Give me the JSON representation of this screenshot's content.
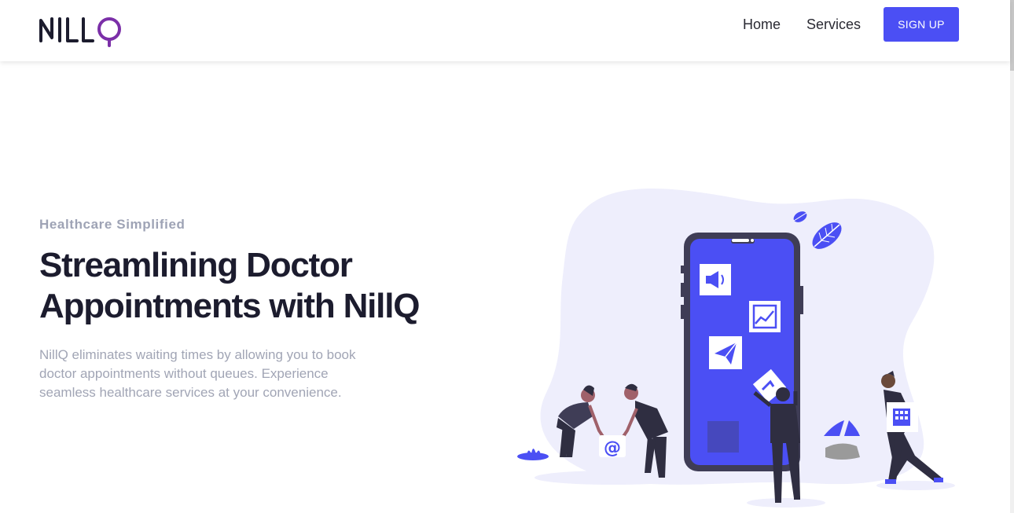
{
  "header": {
    "logo_text": "NILLQ",
    "nav": [
      {
        "label": "Home"
      },
      {
        "label": "Services"
      }
    ],
    "signup_label": "SIGN UP"
  },
  "hero": {
    "eyebrow": "Healthcare Simplified",
    "headline_line1": "Streamlining Doctor",
    "headline_line2": "Appointments with NillQ",
    "description": "NillQ eliminates waiting times by allowing you to book doctor appointments without queues. Experience seamless healthcare services at your convenience."
  },
  "illustration": {
    "icons": [
      "megaphone-icon",
      "chart-icon",
      "paper-plane-icon",
      "at-sign-icon",
      "building-icon"
    ],
    "at_symbol": "@",
    "colors": {
      "accent": "#4b4ff4",
      "blob": "#eeeefc",
      "dark": "#2f2e41",
      "logo_purple": "#7b2fa8"
    }
  },
  "colors": {
    "brand_button": "#4b4ff4",
    "headline": "#1c1c2e",
    "muted_text": "#a1a5b5"
  }
}
